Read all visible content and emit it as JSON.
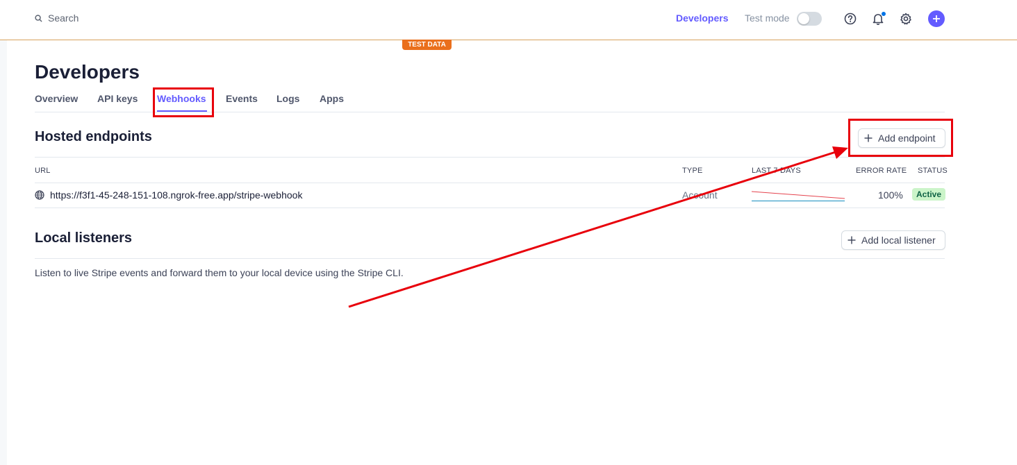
{
  "topbar": {
    "search_placeholder": "Search",
    "developers_link": "Developers",
    "test_mode_label": "Test mode",
    "test_mode_on": false,
    "icons": [
      "search-icon",
      "help-icon",
      "bell-icon",
      "gear-icon",
      "plus-icon"
    ]
  },
  "banner": {
    "test_data": "TEST DATA"
  },
  "page": {
    "title": "Developers",
    "tabs": [
      {
        "label": "Overview",
        "active": false
      },
      {
        "label": "API keys",
        "active": false
      },
      {
        "label": "Webhooks",
        "active": true
      },
      {
        "label": "Events",
        "active": false
      },
      {
        "label": "Logs",
        "active": false
      },
      {
        "label": "Apps",
        "active": false
      }
    ]
  },
  "hosted": {
    "title": "Hosted endpoints",
    "add_button": "Add endpoint",
    "columns": [
      "URL",
      "TYPE",
      "LAST 7 DAYS",
      "ERROR RATE",
      "STATUS"
    ],
    "rows": [
      {
        "url": "https://f3f1-45-248-151-108.ngrok-free.app/stripe-webhook",
        "type": "Account",
        "error_rate": "100%",
        "status": "Active"
      }
    ]
  },
  "local": {
    "title": "Local listeners",
    "add_button": "Add local listener",
    "description": "Listen to live Stripe events and forward them to your local device using the Stripe CLI."
  },
  "colors": {
    "accent": "#635bff",
    "annotation": "#e8000b",
    "status_bg": "#cbf4c9",
    "status_text": "#0e6245",
    "test_banner": "#ea6f1c"
  }
}
